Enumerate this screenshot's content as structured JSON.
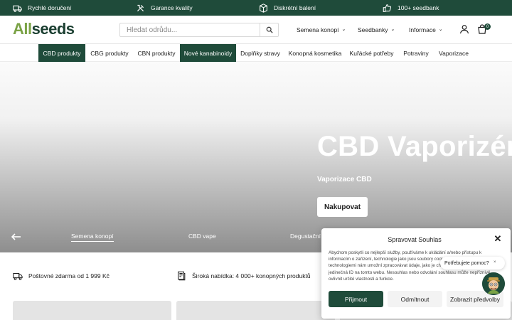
{
  "topbar": {
    "perks": [
      {
        "label": "Rychlé doručení",
        "icon": "truck-icon"
      },
      {
        "label": "Garance kvality",
        "icon": "tools-icon"
      },
      {
        "label": "Diskrétní balení",
        "icon": "box-icon"
      },
      {
        "label": "100+ seedbank",
        "icon": "thumbs-up-icon"
      }
    ]
  },
  "header": {
    "logo_all": "All",
    "logo_seeds": "seeds",
    "search_placeholder": "Hledat odrůdu...",
    "nav": [
      {
        "label": "Semena konopí"
      },
      {
        "label": "Seedbanky"
      },
      {
        "label": "Informace"
      }
    ],
    "cart_count": "0"
  },
  "categories": [
    {
      "label": "CBD produkty",
      "active": true
    },
    {
      "label": "CBG produkty",
      "active": false
    },
    {
      "label": "CBN produkty",
      "active": false
    },
    {
      "label": "Nové kanabinoidy",
      "active": true
    },
    {
      "label": "Doplňky stravy",
      "active": false
    },
    {
      "label": "Konopná kosmetika",
      "active": false
    },
    {
      "label": "Kuřácké potřeby",
      "active": false
    },
    {
      "label": "Potraviny",
      "active": false
    },
    {
      "label": "Vaporizace",
      "active": false
    }
  ],
  "hero": {
    "title": "CBD Vaporizéry",
    "subtitle": "Vaporizace CBD",
    "cta": "Nakupovat",
    "slides": [
      {
        "label": "Semena konopí",
        "active": true
      },
      {
        "label": "CBD vape",
        "active": false
      },
      {
        "label": "Degustační b",
        "active": false
      }
    ]
  },
  "features": [
    {
      "label": "Poštovné zdarma od 1 999 Kč",
      "icon": "delivery-truck-icon"
    },
    {
      "label": "Široká nabídka: 4 000+ konopných produktů",
      "icon": "catalog-icon"
    }
  ],
  "consent": {
    "title": "Spravovat Souhlas",
    "text": "Abychom poskytli co nejlepší služby, používáme k ukládání a/nebo přístupu k informacím o zařízení, technologie jako jsou soubory cookies. Souhlas s těmito technologiemi nám umožní zpracovávat údaje, jako je chování při procházení nebo jedinečná ID na tomto webu. Nesouhlas nebo odvolání souhlasu může nepříznivě ovlivnit určité vlastnosti a funkce.",
    "accept": "Přijmout",
    "reject": "Odmítnout",
    "preferences": "Zobrazit předvolby"
  },
  "help": {
    "label": "Potřebujete pomoc?",
    "close": "×"
  },
  "colors": {
    "brand_dark": "#1f4b3a",
    "brand_light": "#7aa245"
  }
}
